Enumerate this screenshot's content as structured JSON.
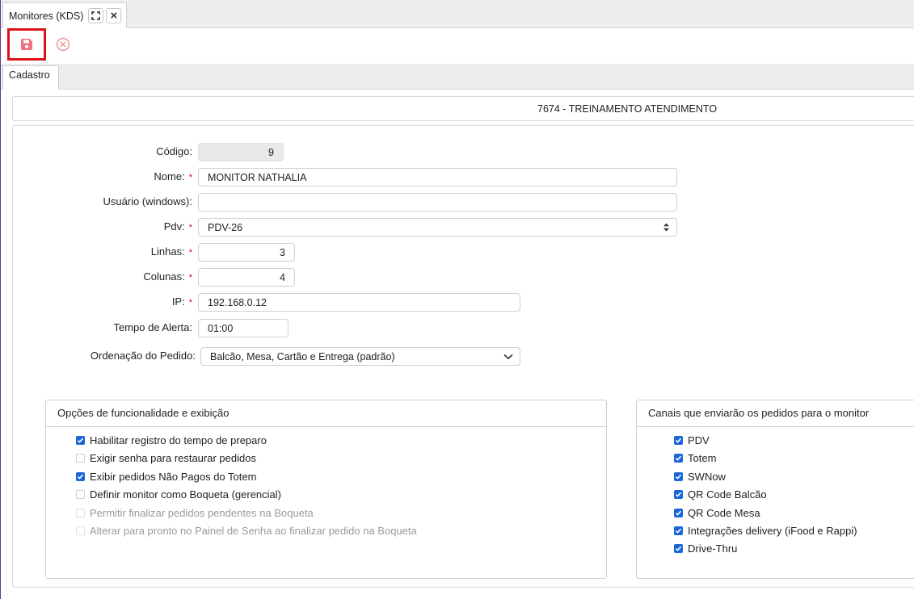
{
  "tab": {
    "title": "Monitores (KDS)",
    "maximize_icon": "expand-icon",
    "close_glyph": "×"
  },
  "toolbar": {
    "save_icon": "floppy-disk-icon",
    "cancel_icon": "circle-x-icon",
    "save_color": "#f07080",
    "cancel_color": "#f09090"
  },
  "subtabs": [
    {
      "label": "Cadastro"
    }
  ],
  "banner": {
    "text": "7674 - TREINAMENTO ATENDIMENTO"
  },
  "form": {
    "codigo": {
      "label": "Código:",
      "value": "9"
    },
    "nome": {
      "label": "Nome:",
      "value": "MONITOR NATHALIA",
      "required": "*"
    },
    "usuario": {
      "label": "Usuário (windows):",
      "value": ""
    },
    "pdv": {
      "label": "Pdv:",
      "value": "PDV-26",
      "required": "*"
    },
    "linhas": {
      "label": "Linhas:",
      "value": "3",
      "required": "*"
    },
    "colunas": {
      "label": "Colunas:",
      "value": "4",
      "required": "*"
    },
    "ip": {
      "label": "IP:",
      "value": "192.168.0.12",
      "required": "*"
    },
    "tempo_alerta": {
      "label": "Tempo de Alerta:",
      "value": "01:00"
    },
    "ordenacao": {
      "label": "Ordenação do Pedido:",
      "value": "Balcão, Mesa, Cartão e Entrega (padrão)"
    }
  },
  "opcoes": {
    "title": "Opções de funcionalidade e exibição",
    "items": [
      {
        "label": "Habilitar registro do tempo de preparo",
        "checked": true,
        "enabled": true
      },
      {
        "label": "Exigir senha para restaurar pedidos",
        "checked": false,
        "enabled": true
      },
      {
        "label": "Exibir pedidos Não Pagos do Totem",
        "checked": true,
        "enabled": true
      },
      {
        "label": "Definir monitor como Boqueta (gerencial)",
        "checked": false,
        "enabled": true
      },
      {
        "label": "Permitir finalizar pedidos pendentes na Boqueta",
        "checked": false,
        "enabled": false
      },
      {
        "label": "Alterar para pronto no Painel de Senha ao finalizar pedido na Boqueta",
        "checked": false,
        "enabled": false
      }
    ]
  },
  "canais": {
    "title": "Canais que enviarão os pedidos para o monitor",
    "items": [
      {
        "label": "PDV",
        "checked": true
      },
      {
        "label": "Totem",
        "checked": true
      },
      {
        "label": "SWNow",
        "checked": true
      },
      {
        "label": "QR Code Balcão",
        "checked": true
      },
      {
        "label": "QR Code Mesa",
        "checked": true
      },
      {
        "label": "Integrações delivery (iFood e Rappi)",
        "checked": true
      },
      {
        "label": "Drive-Thru",
        "checked": true
      }
    ]
  },
  "colors": {
    "accent": "#1a66d8",
    "required": "#d0021b",
    "highlight": "#e0101a"
  }
}
